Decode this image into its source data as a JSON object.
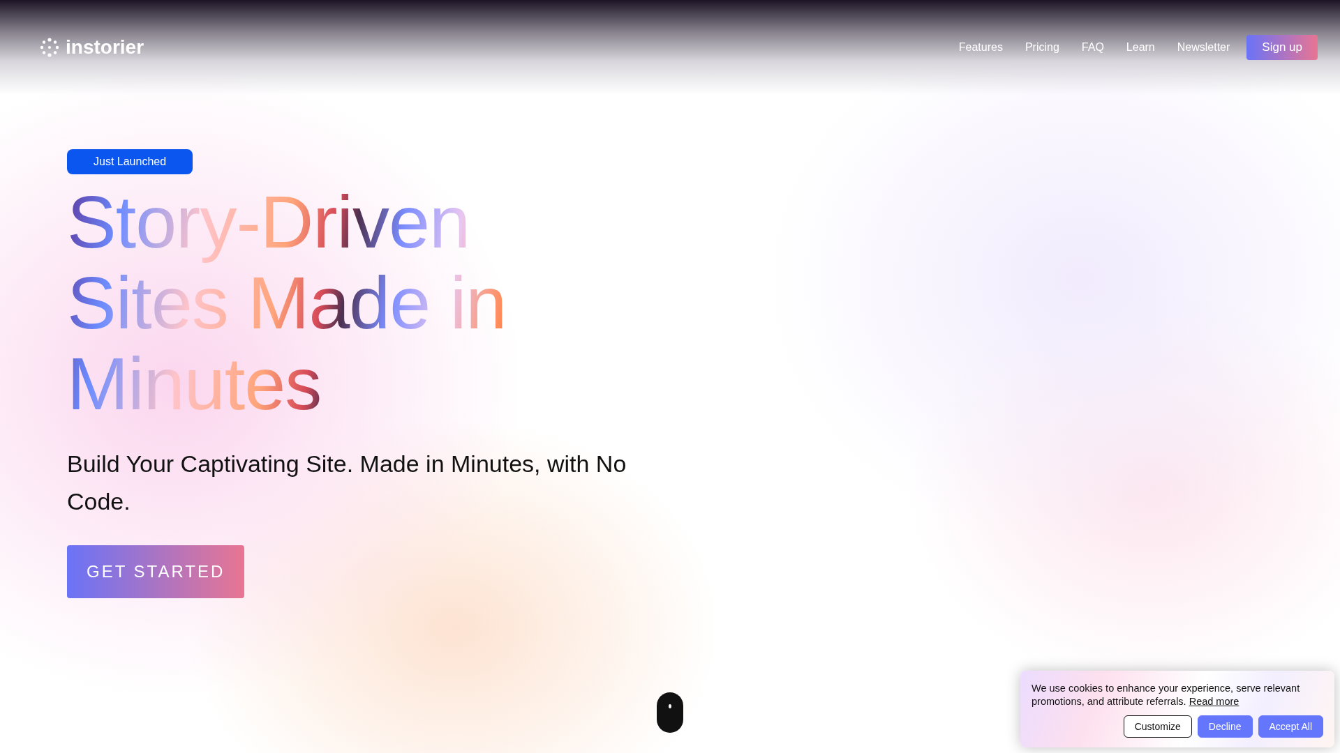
{
  "header": {
    "logo": "instorier",
    "nav": [
      "Features",
      "Pricing",
      "FAQ",
      "Learn",
      "Newsletter"
    ],
    "signup": "Sign up"
  },
  "hero": {
    "badge": "Just Launched",
    "headline": "Story-Driven Sites Made in Minutes",
    "subtitle": "Build Your Captivating Site. Made in Minutes, with No Code.",
    "cta": "GET STARTED"
  },
  "cookie_banner": {
    "text": "We use cookies to enhance your experience, serve relevant promotions, and attribute referrals.",
    "link": "Read more",
    "buttons": [
      {
        "label": "Customize",
        "kind": "outline"
      },
      {
        "label": "Decline",
        "kind": "filled"
      },
      {
        "label": "Accept All",
        "kind": "filled"
      }
    ]
  }
}
